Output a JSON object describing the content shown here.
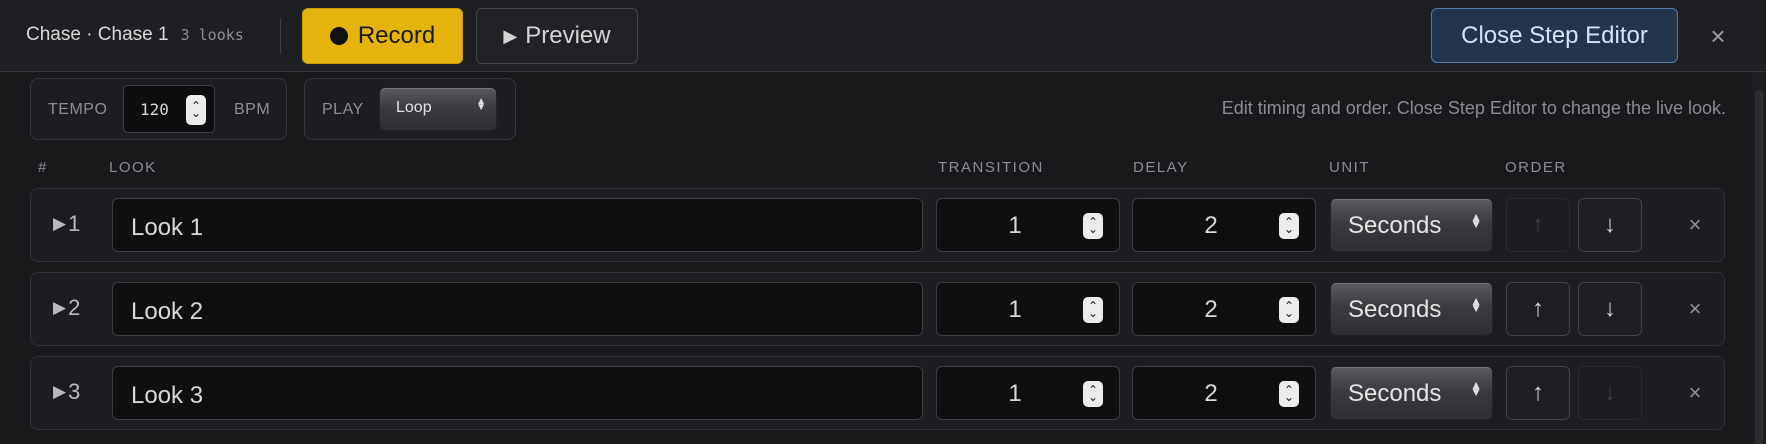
{
  "header": {
    "title": "Chase · Chase 1",
    "count": "3 looks",
    "record_label": "Record",
    "preview_label": "Preview",
    "close_editor_label": "Close Step Editor",
    "close_icon": "×"
  },
  "controls": {
    "tempo_label": "TEMPO",
    "tempo_value": "120",
    "tempo_unit": "BPM",
    "play_label": "PLAY",
    "play_mode": "Loop",
    "hint": "Edit timing and order. Close Step Editor to change the live look."
  },
  "columns": {
    "num": "#",
    "look": "LOOK",
    "transition": "TRANSITION",
    "delay": "DELAY",
    "unit": "UNIT",
    "order": "ORDER"
  },
  "rows": [
    {
      "num": "1",
      "look": "Look 1",
      "transition": "1",
      "delay": "2",
      "unit": "Seconds",
      "up_enabled": false,
      "down_enabled": true
    },
    {
      "num": "2",
      "look": "Look 2",
      "transition": "1",
      "delay": "2",
      "unit": "Seconds",
      "up_enabled": true,
      "down_enabled": true
    },
    {
      "num": "3",
      "look": "Look 3",
      "transition": "1",
      "delay": "2",
      "unit": "Seconds",
      "up_enabled": true,
      "down_enabled": false
    }
  ],
  "icons": {
    "record": "record-dot-icon",
    "preview": "play-icon",
    "close": "close-icon",
    "row_play": "play-icon",
    "up": "arrow-up-icon",
    "down": "arrow-down-icon",
    "remove": "close-icon"
  },
  "colors": {
    "record_bg": "#e4b30e",
    "close_editor_border": "#4f7aa8",
    "background": "#1b1c1f"
  }
}
